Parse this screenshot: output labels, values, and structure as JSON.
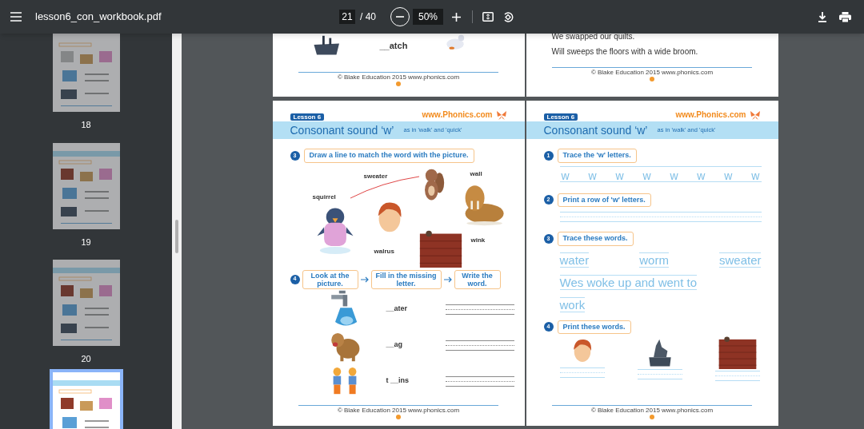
{
  "toolbar": {
    "title": "lesson6_con_workbook.pdf",
    "page_input": "21",
    "page_total": "/ 40",
    "zoom": "50%"
  },
  "thumbnails": [
    {
      "label": "18",
      "selected": false
    },
    {
      "label": "19",
      "selected": false
    },
    {
      "label": "20",
      "selected": false
    },
    {
      "selected": true
    }
  ],
  "top_pages": [
    {
      "lines": [
        "__atch"
      ],
      "footer": "© Blake Education 2015  www.phonics.com"
    },
    {
      "lines": [
        "We swapped our quilts.",
        "Will sweeps the floors with a wide broom."
      ],
      "footer": "© Blake Education 2015  www.phonics.com"
    }
  ],
  "left_page": {
    "header": {
      "lesson": "Lesson 6",
      "site": "www.Phonics.com",
      "title": "Consonant sound ‘w’",
      "subtitle": "as in 'walk' and 'quick'"
    },
    "activity_3": {
      "number": "3",
      "instruction": "Draw a line to match the word with the picture.",
      "words": [
        "sweater",
        "wall",
        "squirrel",
        "walrus",
        "wink"
      ]
    },
    "activity_4": {
      "number": "4",
      "steps": [
        "Look at the picture.",
        "Fill in the missing letter.",
        "Write the word."
      ],
      "rows": [
        "__ater",
        "__ag",
        "t __ins"
      ]
    },
    "footer": "© Blake Education 2015  www.phonics.com"
  },
  "right_page": {
    "header": {
      "lesson": "Lesson 6",
      "site": "www.Phonics.com",
      "title": "Consonant sound ‘w’",
      "subtitle": "as in 'walk' and 'quick'"
    },
    "activity_1": {
      "number": "1",
      "instruction": "Trace the 'w' letters.",
      "trace_letters": [
        "w",
        "w",
        "w",
        "w",
        "w",
        "w",
        "w",
        "w"
      ]
    },
    "activity_2": {
      "number": "2",
      "instruction": "Print a row of 'w' letters."
    },
    "activity_3": {
      "number": "3",
      "instruction": "Trace these words.",
      "trace_words": [
        "water",
        "worm",
        "sweater"
      ],
      "trace_sentence": [
        "Wes woke up and went to",
        "work"
      ]
    },
    "activity_4": {
      "number": "4",
      "instruction": "Print these words."
    },
    "footer": "© Blake Education 2015  www.phonics.com"
  }
}
